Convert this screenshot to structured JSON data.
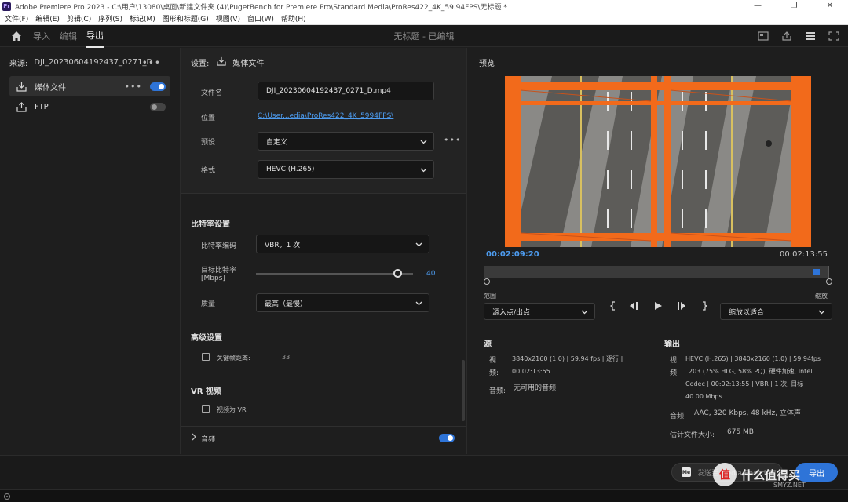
{
  "window": {
    "title": "Adobe Premiere Pro 2023 - C:\\用户\\13080\\桌面\\新建文件夹 (4)\\PugetBench for Premiere Pro\\Standard Media\\ProRes422_4K_59.94FPS\\无标题 *",
    "app_badge": "Pr",
    "minimize": "—",
    "maximize": "❐",
    "close": "✕"
  },
  "menu": [
    "文件(F)",
    "编辑(E)",
    "剪辑(C)",
    "序列(S)",
    "标记(M)",
    "图形和标题(G)",
    "视图(V)",
    "窗口(W)",
    "帮助(H)"
  ],
  "header": {
    "tabs": [
      "导入",
      "编辑",
      "导出"
    ],
    "active_tab": "导出",
    "center_title": "无标题 - 已编辑"
  },
  "left": {
    "source_label": "来源:",
    "source_file": "DJI_20230604192437_0271_D",
    "more": "•••",
    "destinations": [
      {
        "label": "媒体文件",
        "icon": "download-icon",
        "enabled": true,
        "selected": true
      },
      {
        "label": "FTP",
        "icon": "upload-icon",
        "enabled": false,
        "selected": false
      }
    ]
  },
  "settings": {
    "label": "设置:",
    "title": "媒体文件",
    "filename_label": "文件名",
    "filename": "DJI_20230604192437_0271_D.mp4",
    "location_label": "位置",
    "location": "C:\\User...edia\\ProRes422_4K_5994FPS\\",
    "preset_label": "预设",
    "preset": "自定义",
    "format_label": "格式",
    "format": "HEVC (H.265)",
    "more": "•••"
  },
  "bitrate": {
    "section": "比特率设置",
    "encoding_label": "比特率编码",
    "encoding": "VBR，1 次",
    "target_label": "目标比特率",
    "target_unit": "[Mbps]",
    "target_value": "40",
    "target_fraction": 0.9,
    "quality_label": "质量",
    "quality": "最高（最慢）"
  },
  "advanced": {
    "section": "高级设置",
    "keyframe_label": "关键帧距离:",
    "keyframe_value": "33"
  },
  "vr": {
    "section": "VR 视频",
    "as_vr_label": "视频为 VR"
  },
  "audio": {
    "label": "音频",
    "enabled": true
  },
  "preview": {
    "title": "预览",
    "timecode_current": "00:02:09:20",
    "timecode_duration": "00:02:13:55",
    "range_label": "范围",
    "range_value": "源入点/出点",
    "zoom_label": "缩放",
    "zoom_value": "缩放以适合",
    "playhead_fraction": 0.97
  },
  "summary": {
    "source_head": "源",
    "source_video_key": "视频:",
    "source_video": [
      "3840x2160 (1.0) | 59.94 fps | 逐行 |",
      "00:02:13:55"
    ],
    "source_audio_key": "音频:",
    "source_audio": "无可用的音频",
    "output_head": "输出",
    "output_video_key": "视频:",
    "output_video": [
      "HEVC (H.265) | 3840x2160 (1.0) | 59.94fps",
      "203 (75% HLG, 58% PQ), 硬件加速, Intel",
      "Codec | 00:02:13:55 | VBR | 1 次, 目标",
      "40.00 Mbps"
    ],
    "output_audio_key": "音频:",
    "output_audio": "AAC, 320 Kbps, 48 kHz, 立体声",
    "filesize_key": "估计文件大小:",
    "filesize": "675 MB"
  },
  "bottom": {
    "send_badge": "Me",
    "send_label": "发送至 Media Encoder",
    "export_label": "导出"
  },
  "watermark": {
    "glyph": "值",
    "text": "什么值得买",
    "sub": "SMYZ.NET"
  },
  "colors": {
    "accent": "#2e74d8",
    "link": "#4d9cf0",
    "bridge_orange": "#f26a1b"
  }
}
